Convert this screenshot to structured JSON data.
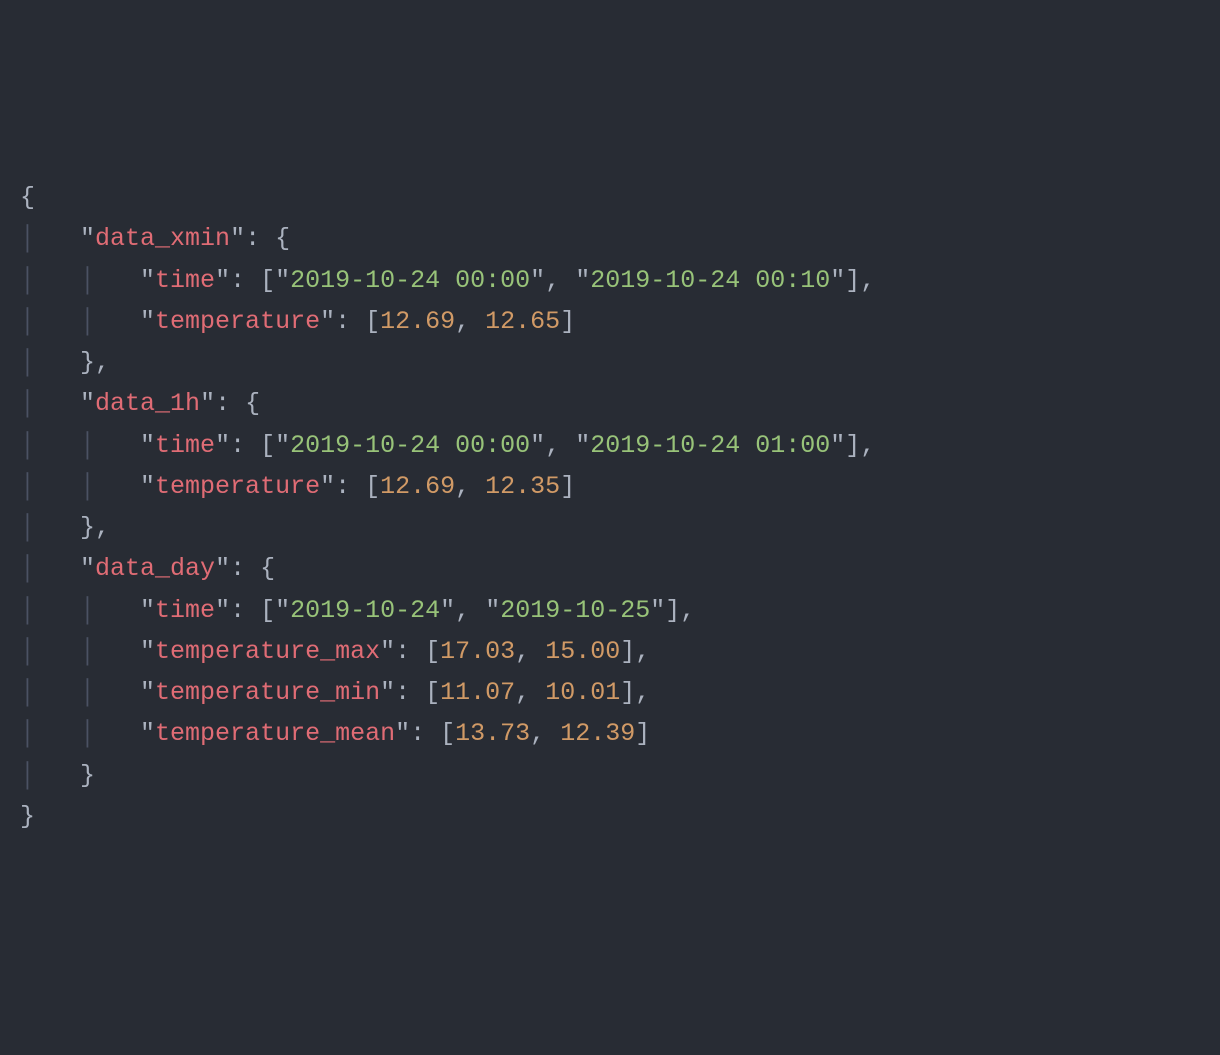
{
  "code": {
    "open_brace": "{",
    "close_brace": "}",
    "open_bracket": "[",
    "close_bracket": "]",
    "colon_space": ": ",
    "comma": ",",
    "quote": "\"",
    "guide1": "│   ",
    "guide2": "│   │   ",
    "data_xmin": {
      "key": "data_xmin",
      "time_key": "time",
      "time_vals": [
        "2019-10-24 00:00",
        "2019-10-24 00:10"
      ],
      "temp_key": "temperature",
      "temp_vals": [
        "12.69",
        "12.65"
      ]
    },
    "data_1h": {
      "key": "data_1h",
      "time_key": "time",
      "time_vals": [
        "2019-10-24 00:00",
        "2019-10-24 01:00"
      ],
      "temp_key": "temperature",
      "temp_vals": [
        "12.69",
        "12.35"
      ]
    },
    "data_day": {
      "key": "data_day",
      "time_key": "time",
      "time_vals": [
        "2019-10-24",
        "2019-10-25"
      ],
      "tmax_key": "temperature_max",
      "tmax_vals": [
        "17.03",
        "15.00"
      ],
      "tmin_key": "temperature_min",
      "tmin_vals": [
        "11.07",
        "10.01"
      ],
      "tmean_key": "temperature_mean",
      "tmean_vals": [
        "13.73",
        "12.39"
      ]
    }
  }
}
